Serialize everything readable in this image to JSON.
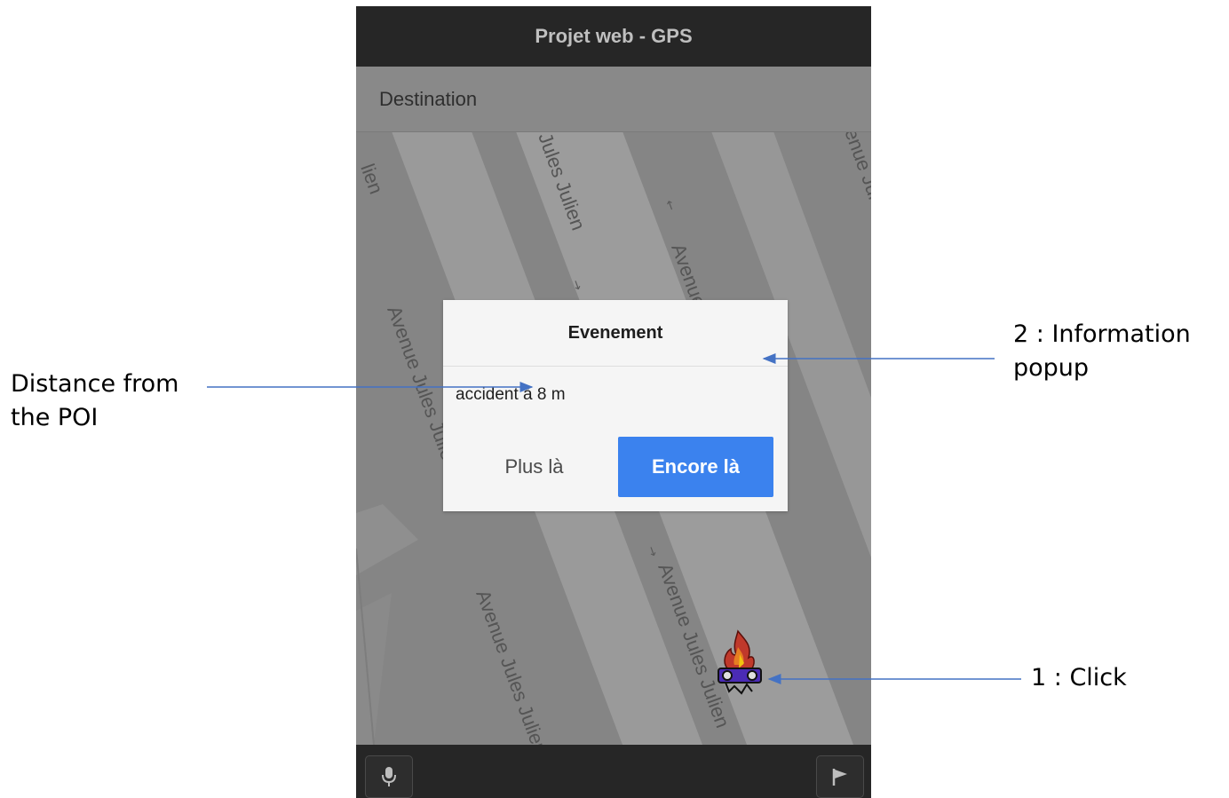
{
  "app": {
    "title": "Projet web - GPS",
    "destination_placeholder": "Destination"
  },
  "map": {
    "street_labels": [
      "Jules Julien",
      "Avenue Jules Julien",
      "Avenue Jules Julien",
      "Avenue Jules Julien",
      "Avenue Jules Julien",
      "enue Jules",
      "lien"
    ],
    "poi_icon": "accident-car-fire-icon"
  },
  "popup": {
    "title": "Evenement",
    "message": "accident à 8 m",
    "button_left": "Plus là",
    "button_right": "Encore là",
    "accent_color": "#3b82ee"
  },
  "bottom_bar": {
    "left_icon": "microphone-icon",
    "right_icon": "flag-icon"
  },
  "annotations": {
    "distance_line1": "Distance from",
    "distance_line2": "the POI",
    "info_line1": "2 : Information",
    "info_line2": "popup",
    "click": "1 : Click",
    "arrow_color": "#4472c4"
  }
}
